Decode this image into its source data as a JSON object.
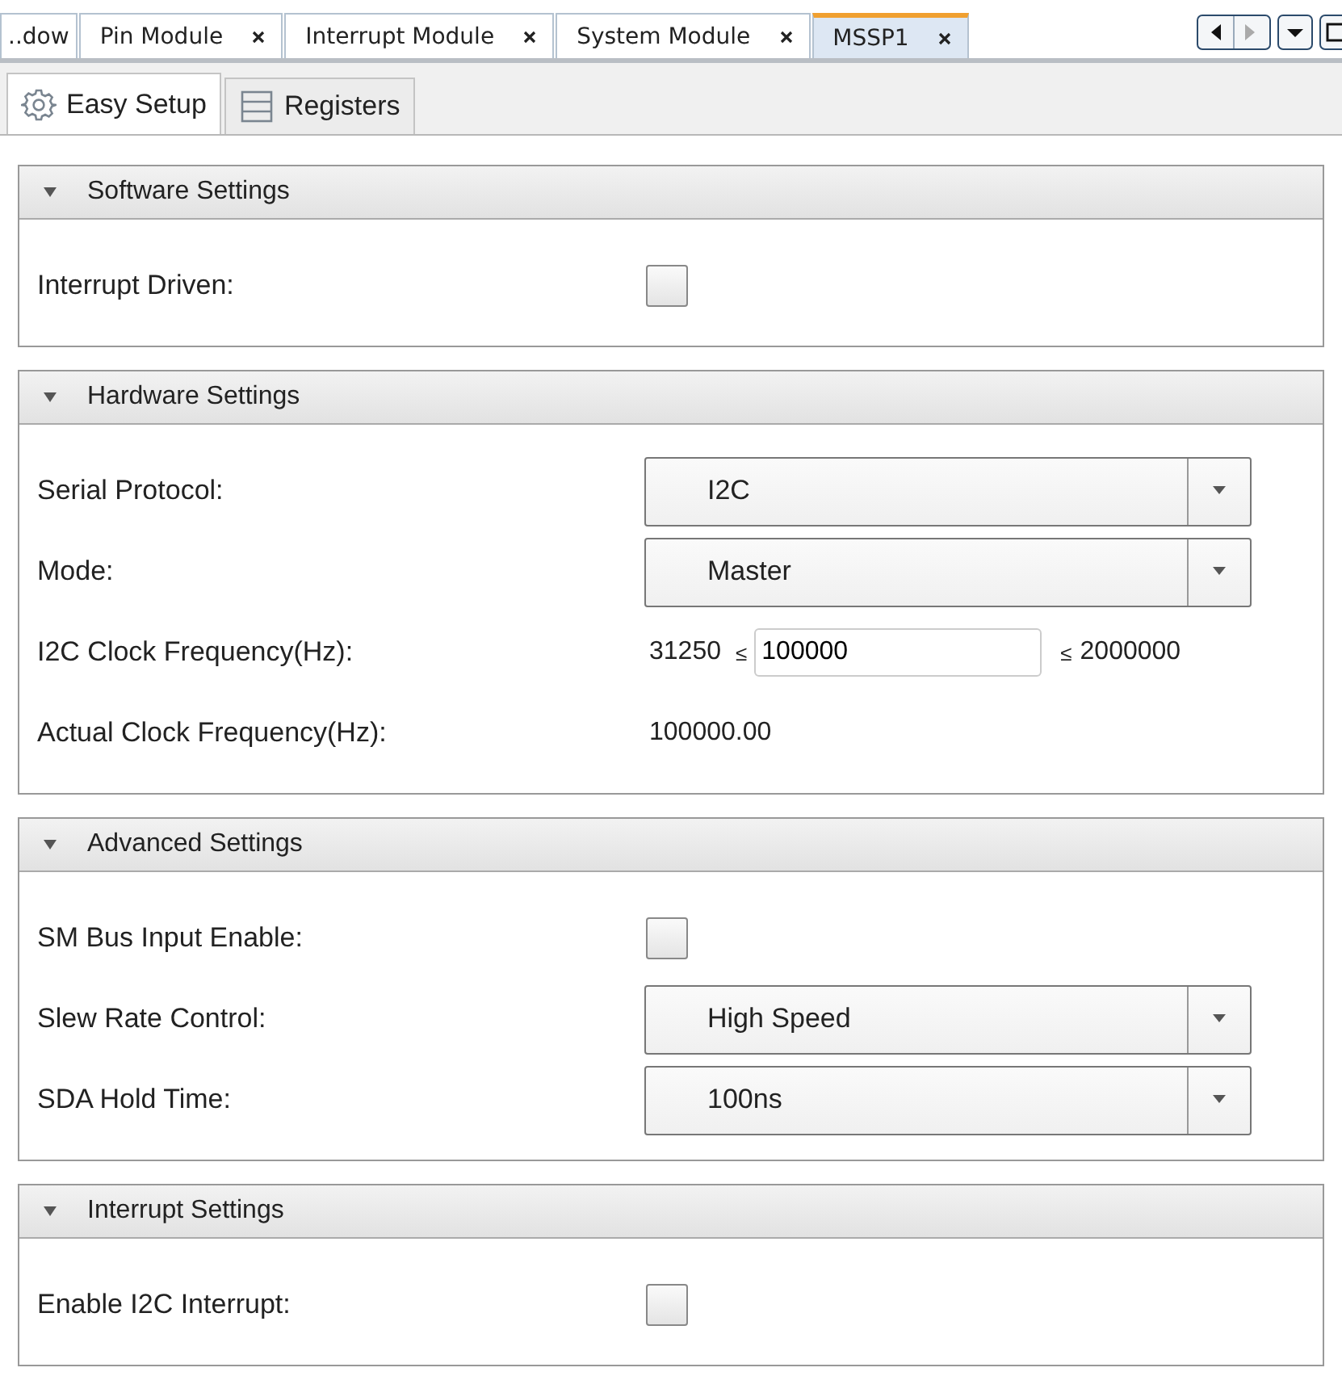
{
  "editor_tabs": [
    {
      "label": "..dow",
      "selected": false,
      "closable": false
    },
    {
      "label": "Pin Module",
      "selected": false,
      "closable": true
    },
    {
      "label": "Interrupt Module",
      "selected": false,
      "closable": true
    },
    {
      "label": "System Module",
      "selected": false,
      "closable": true
    },
    {
      "label": "MSSP1",
      "selected": true,
      "closable": true
    }
  ],
  "view_tabs": [
    {
      "label": "Easy Setup",
      "kind": "gear",
      "selected": true
    },
    {
      "label": "Registers",
      "kind": "list",
      "selected": false
    }
  ],
  "sections": [
    {
      "title": "Software Settings",
      "expanded": true,
      "rows": [
        {
          "kind": "checkbox",
          "label": "Interrupt Driven:",
          "checked": false
        }
      ]
    },
    {
      "title": "Hardware Settings",
      "expanded": true,
      "rows": [
        {
          "kind": "select",
          "label": "Serial Protocol:",
          "value": "I2C"
        },
        {
          "kind": "select",
          "label": "Mode:",
          "value": "Master"
        },
        {
          "kind": "range",
          "label": "I2C Clock Frequency(Hz):",
          "min": "31250",
          "min_sign": "≤",
          "value": "100000",
          "max_sign": "≤",
          "max": "2000000"
        },
        {
          "kind": "text",
          "label": "Actual Clock Frequency(Hz):",
          "value": "100000.00"
        }
      ]
    },
    {
      "title": "Advanced Settings",
      "expanded": true,
      "rows": [
        {
          "kind": "checkbox",
          "label": "SM Bus Input Enable:",
          "checked": false
        },
        {
          "kind": "select",
          "label": "Slew Rate Control:",
          "value": "High Speed"
        },
        {
          "kind": "select",
          "label": "SDA Hold Time:",
          "value": "100ns"
        }
      ]
    },
    {
      "title": "Interrupt Settings",
      "expanded": true,
      "rows": [
        {
          "kind": "checkbox",
          "label": "Enable I2C Interrupt:",
          "checked": false
        }
      ]
    }
  ]
}
